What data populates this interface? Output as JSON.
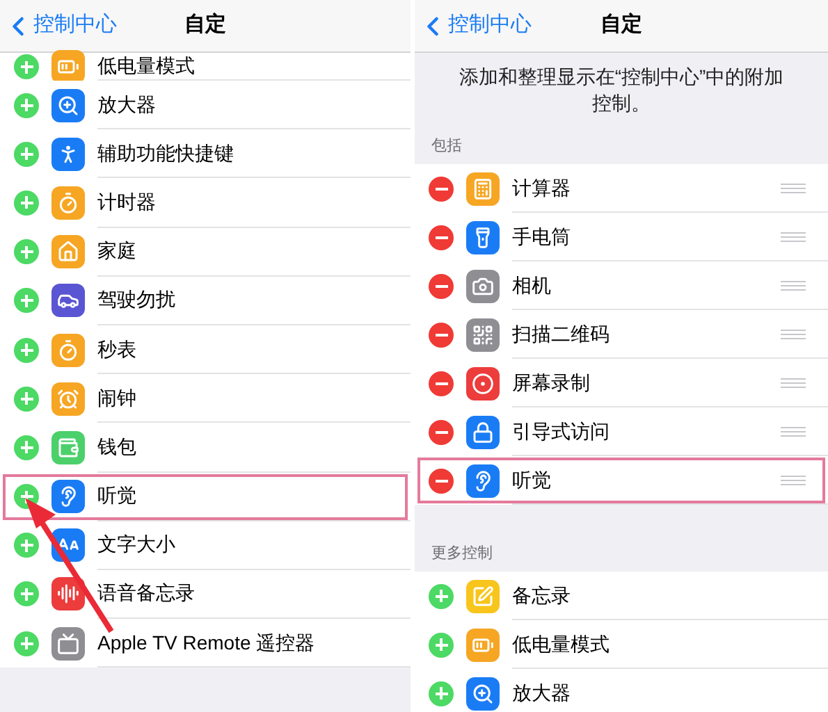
{
  "left": {
    "nav": {
      "back": "控制中心",
      "title": "自定"
    },
    "kind": "add",
    "items": [
      {
        "label": "低电量模式",
        "color": "#f6a623",
        "highlighted": false
      },
      {
        "label": "放大器",
        "color": "#1a7cf5",
        "highlighted": false
      },
      {
        "label": "辅助功能快捷键",
        "color": "#1a7cf5",
        "highlighted": false
      },
      {
        "label": "计时器",
        "color": "#f6a623",
        "highlighted": false
      },
      {
        "label": "家庭",
        "color": "#f6a623",
        "highlighted": false
      },
      {
        "label": "驾驶勿扰",
        "color": "#5a55d2",
        "highlighted": false
      },
      {
        "label": "秒表",
        "color": "#f6a623",
        "highlighted": false
      },
      {
        "label": "闹钟",
        "color": "#f6a623",
        "highlighted": false
      },
      {
        "label": "钱包",
        "color": "#4cd06b",
        "highlighted": false
      },
      {
        "label": "听觉",
        "color": "#1a7cf5",
        "highlighted": true
      },
      {
        "label": "文字大小",
        "color": "#1a7cf5",
        "highlighted": false
      },
      {
        "label": "语音备忘录",
        "color": "#ec3c3c",
        "highlighted": false
      },
      {
        "label": "Apple TV Remote 遥控器",
        "color": "#8e8e93",
        "highlighted": false
      }
    ]
  },
  "right": {
    "nav": {
      "back": "控制中心",
      "title": "自定"
    },
    "description": "添加和整理显示在“控制中心”中的附加控制。",
    "sections": [
      {
        "header": "包括",
        "kind": "remove",
        "items": [
          {
            "label": "计算器",
            "color": "#f6a623",
            "highlighted": false
          },
          {
            "label": "手电筒",
            "color": "#1a7cf5",
            "highlighted": false
          },
          {
            "label": "相机",
            "color": "#8e8e93",
            "highlighted": false
          },
          {
            "label": "扫描二维码",
            "color": "#8e8e93",
            "highlighted": false
          },
          {
            "label": "屏幕录制",
            "color": "#ec3c3c",
            "highlighted": false
          },
          {
            "label": "引导式访问",
            "color": "#1a7cf5",
            "highlighted": false
          },
          {
            "label": "听觉",
            "color": "#1a7cf5",
            "highlighted": true
          }
        ]
      },
      {
        "header": "更多控制",
        "kind": "add",
        "items": [
          {
            "label": "备忘录",
            "color": "#f8c51c",
            "highlighted": false
          },
          {
            "label": "低电量模式",
            "color": "#f6a623",
            "highlighted": false
          },
          {
            "label": "放大器",
            "color": "#1a7cf5",
            "highlighted": false
          }
        ]
      }
    ]
  }
}
